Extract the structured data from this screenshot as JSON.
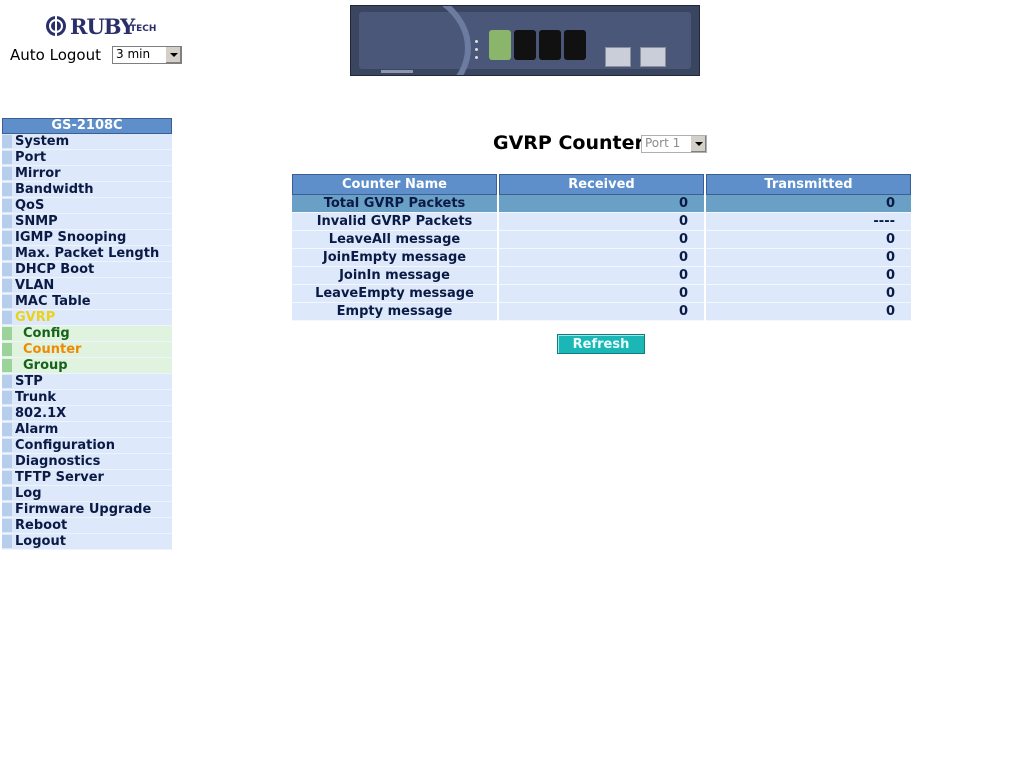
{
  "header": {
    "brand": "RUBY",
    "brand_suffix": "TECH",
    "auto_logout_label": "Auto Logout",
    "auto_logout_value": "3 min"
  },
  "sidebar": {
    "title": "GS-2108C",
    "items": [
      {
        "label": "System"
      },
      {
        "label": "Port"
      },
      {
        "label": "Mirror"
      },
      {
        "label": "Bandwidth"
      },
      {
        "label": "QoS"
      },
      {
        "label": "SNMP"
      },
      {
        "label": "IGMP Snooping"
      },
      {
        "label": "Max. Packet Length"
      },
      {
        "label": "DHCP Boot"
      },
      {
        "label": "VLAN"
      },
      {
        "label": "MAC Table"
      },
      {
        "label": "GVRP"
      },
      {
        "label": "Config"
      },
      {
        "label": "Counter"
      },
      {
        "label": "Group"
      },
      {
        "label": "STP"
      },
      {
        "label": "Trunk"
      },
      {
        "label": "802.1X"
      },
      {
        "label": "Alarm"
      },
      {
        "label": "Configuration"
      },
      {
        "label": "Diagnostics"
      },
      {
        "label": "TFTP Server"
      },
      {
        "label": "Log"
      },
      {
        "label": "Firmware Upgrade"
      },
      {
        "label": "Reboot"
      },
      {
        "label": "Logout"
      }
    ]
  },
  "main": {
    "title": "GVRP Counter",
    "port_select": "Port 1",
    "table": {
      "headers": [
        "Counter Name",
        "Received",
        "Transmitted"
      ],
      "rows": [
        {
          "name": "Total GVRP Packets",
          "received": "0",
          "transmitted": "0"
        },
        {
          "name": "Invalid GVRP Packets",
          "received": "0",
          "transmitted": "----"
        },
        {
          "name": "LeaveAll message",
          "received": "0",
          "transmitted": "0"
        },
        {
          "name": "JoinEmpty message",
          "received": "0",
          "transmitted": "0"
        },
        {
          "name": "JoinIn message",
          "received": "0",
          "transmitted": "0"
        },
        {
          "name": "LeaveEmpty message",
          "received": "0",
          "transmitted": "0"
        },
        {
          "name": "Empty message",
          "received": "0",
          "transmitted": "0"
        }
      ]
    },
    "refresh_label": "Refresh"
  }
}
